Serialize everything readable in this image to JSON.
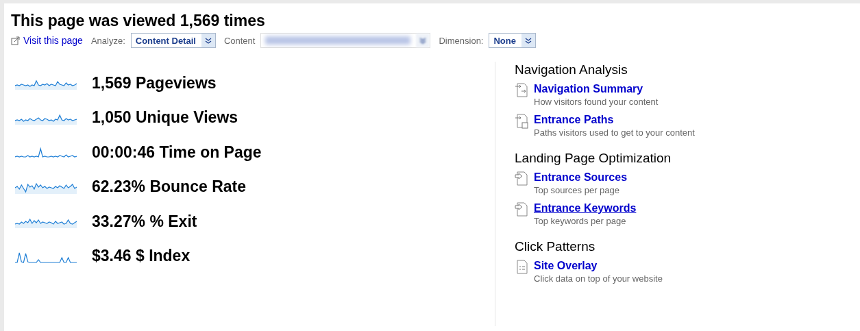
{
  "title": "This page was viewed 1,569 times",
  "toolbar": {
    "visit_link": "Visit this page",
    "analyze_label": "Analyze:",
    "analyze_value": "Content Detail",
    "content_label": "Content",
    "content_blurred": true,
    "dimension_label": "Dimension:",
    "dimension_value": "None"
  },
  "metrics": [
    {
      "value": "1,569",
      "label": "Pageviews",
      "filled": true
    },
    {
      "value": "1,050",
      "label": "Unique Views",
      "filled": true
    },
    {
      "value": "00:00:46",
      "label": "Time on Page",
      "filled": false
    },
    {
      "value": "62.23%",
      "label": "Bounce Rate",
      "filled": true
    },
    {
      "value": "33.27%",
      "label": "% Exit",
      "filled": true
    },
    {
      "value": "$3.46",
      "label": "$ Index",
      "filled": false
    }
  ],
  "sections": [
    {
      "heading": "Navigation Analysis",
      "links": [
        {
          "kind": "flow",
          "title": "Navigation Summary",
          "description": "How visitors found your content",
          "hovered": false
        },
        {
          "kind": "paths",
          "title": "Entrance Paths",
          "description": "Paths visitors used to get to your content",
          "hovered": false
        }
      ]
    },
    {
      "heading": "Landing Page Optimization",
      "links": [
        {
          "kind": "enter",
          "title": "Entrance Sources",
          "description": "Top sources per page",
          "hovered": false
        },
        {
          "kind": "enter",
          "title": "Entrance Keywords",
          "description": "Top keywords per page",
          "hovered": true
        }
      ]
    },
    {
      "heading": "Click Patterns",
      "links": [
        {
          "kind": "page",
          "title": "Site Overlay",
          "description": "Click data on top of your website",
          "hovered": false
        }
      ]
    }
  ]
}
